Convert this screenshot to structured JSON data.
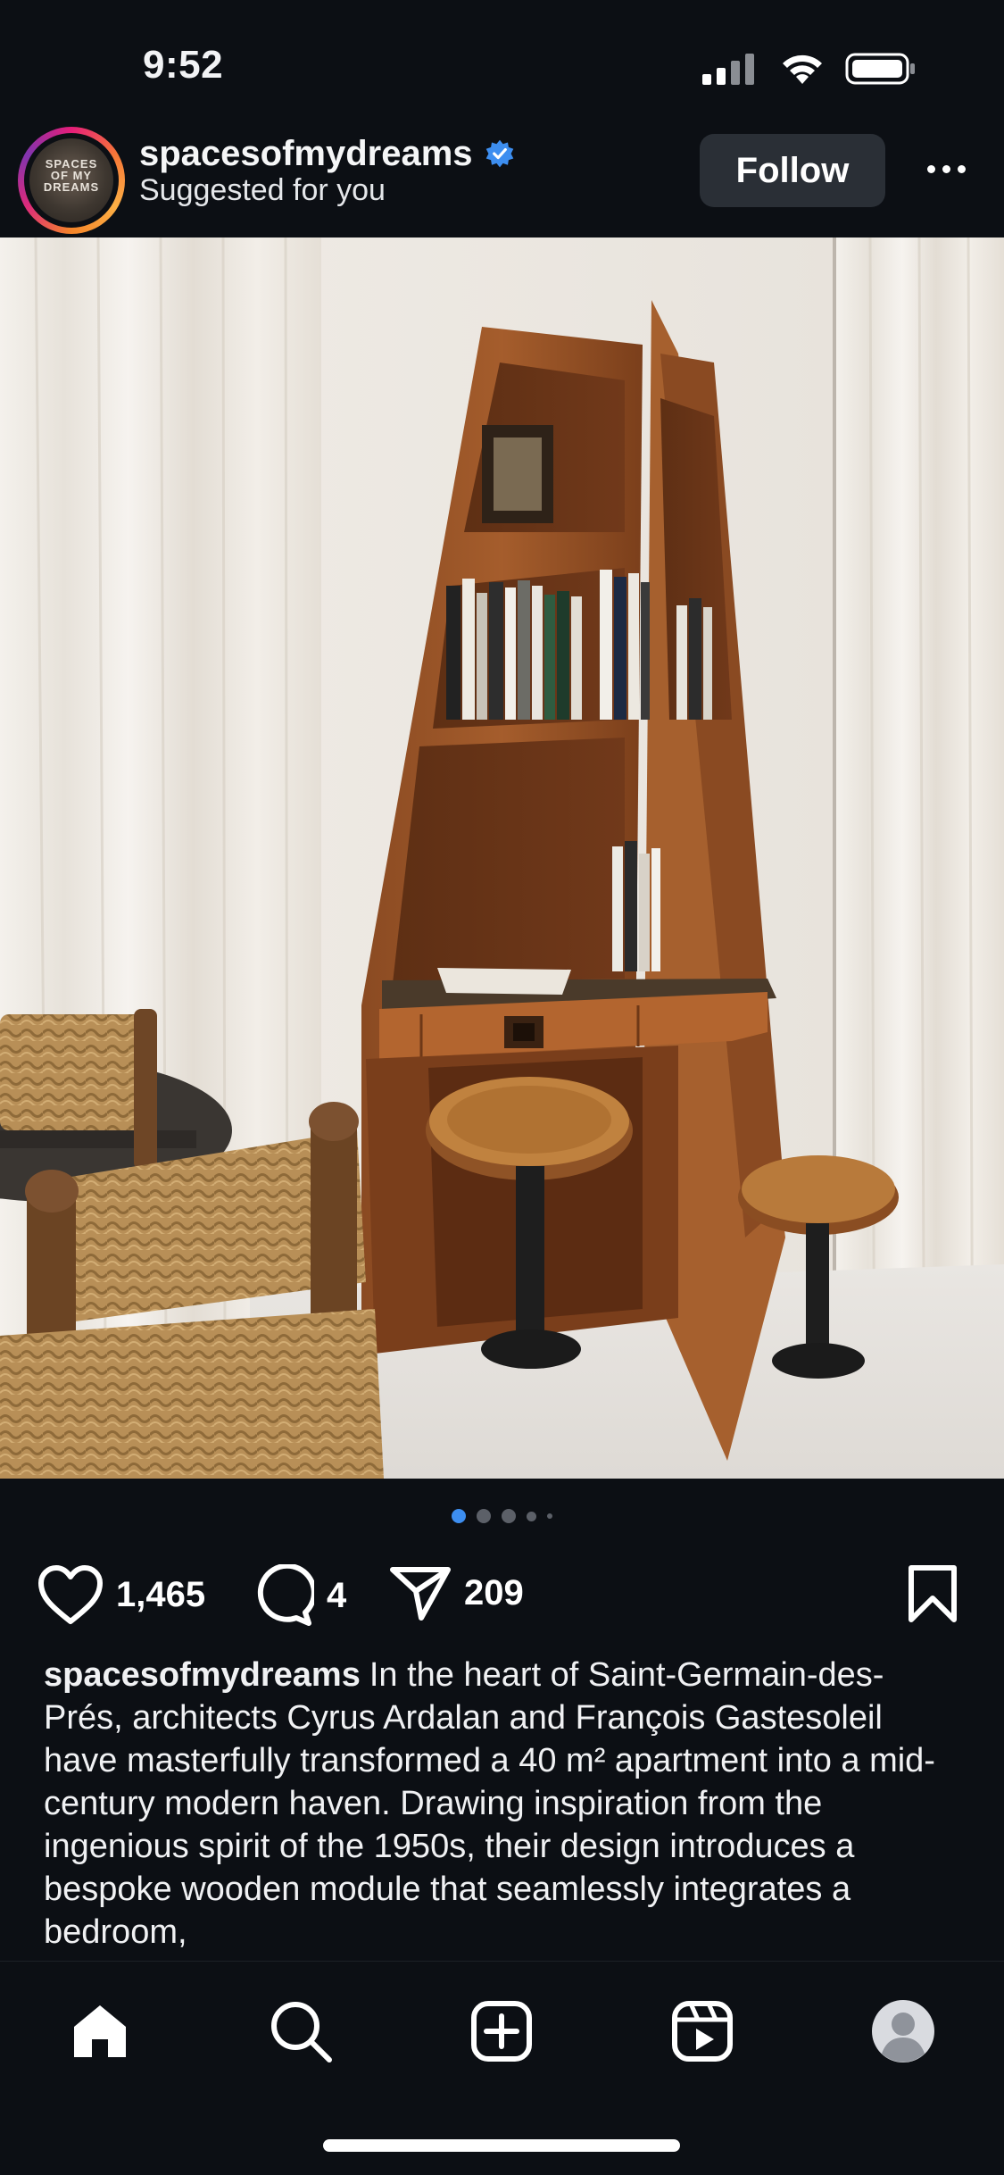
{
  "status_bar": {
    "time": "9:52",
    "icons": [
      "signal-icon",
      "wifi-icon",
      "battery-icon"
    ]
  },
  "post": {
    "username": "spacesofmydreams",
    "subtitle": "Suggested for you",
    "follow_label": "Follow",
    "avatar_text": [
      "SPACES",
      "OF MY",
      "DREAMS"
    ],
    "verified": true,
    "carousel": {
      "count": 5,
      "active_index": 0
    },
    "likes": "1,465",
    "comments": "4",
    "shares": "209",
    "caption_user": "spacesofmydreams",
    "caption_text": "In the heart of Saint-Germain-des-Prés, architects Cyrus Ardalan and François Gastesoleil have masterfully transformed a 40 m² apartment into a mid-century modern haven. Drawing inspiration from the ingenious spirit of the 1950s, their design introduces a bespoke wooden module that seamlessly integrates a bedroom,"
  },
  "nav": {
    "items": [
      "home-icon",
      "search-icon",
      "create-icon",
      "reels-icon",
      "profile-icon"
    ]
  },
  "colors": {
    "background": "#0c0f14",
    "accent": "#3d8ef0",
    "verified": "#3d8ef0",
    "follow_button": "#2a2f36"
  }
}
